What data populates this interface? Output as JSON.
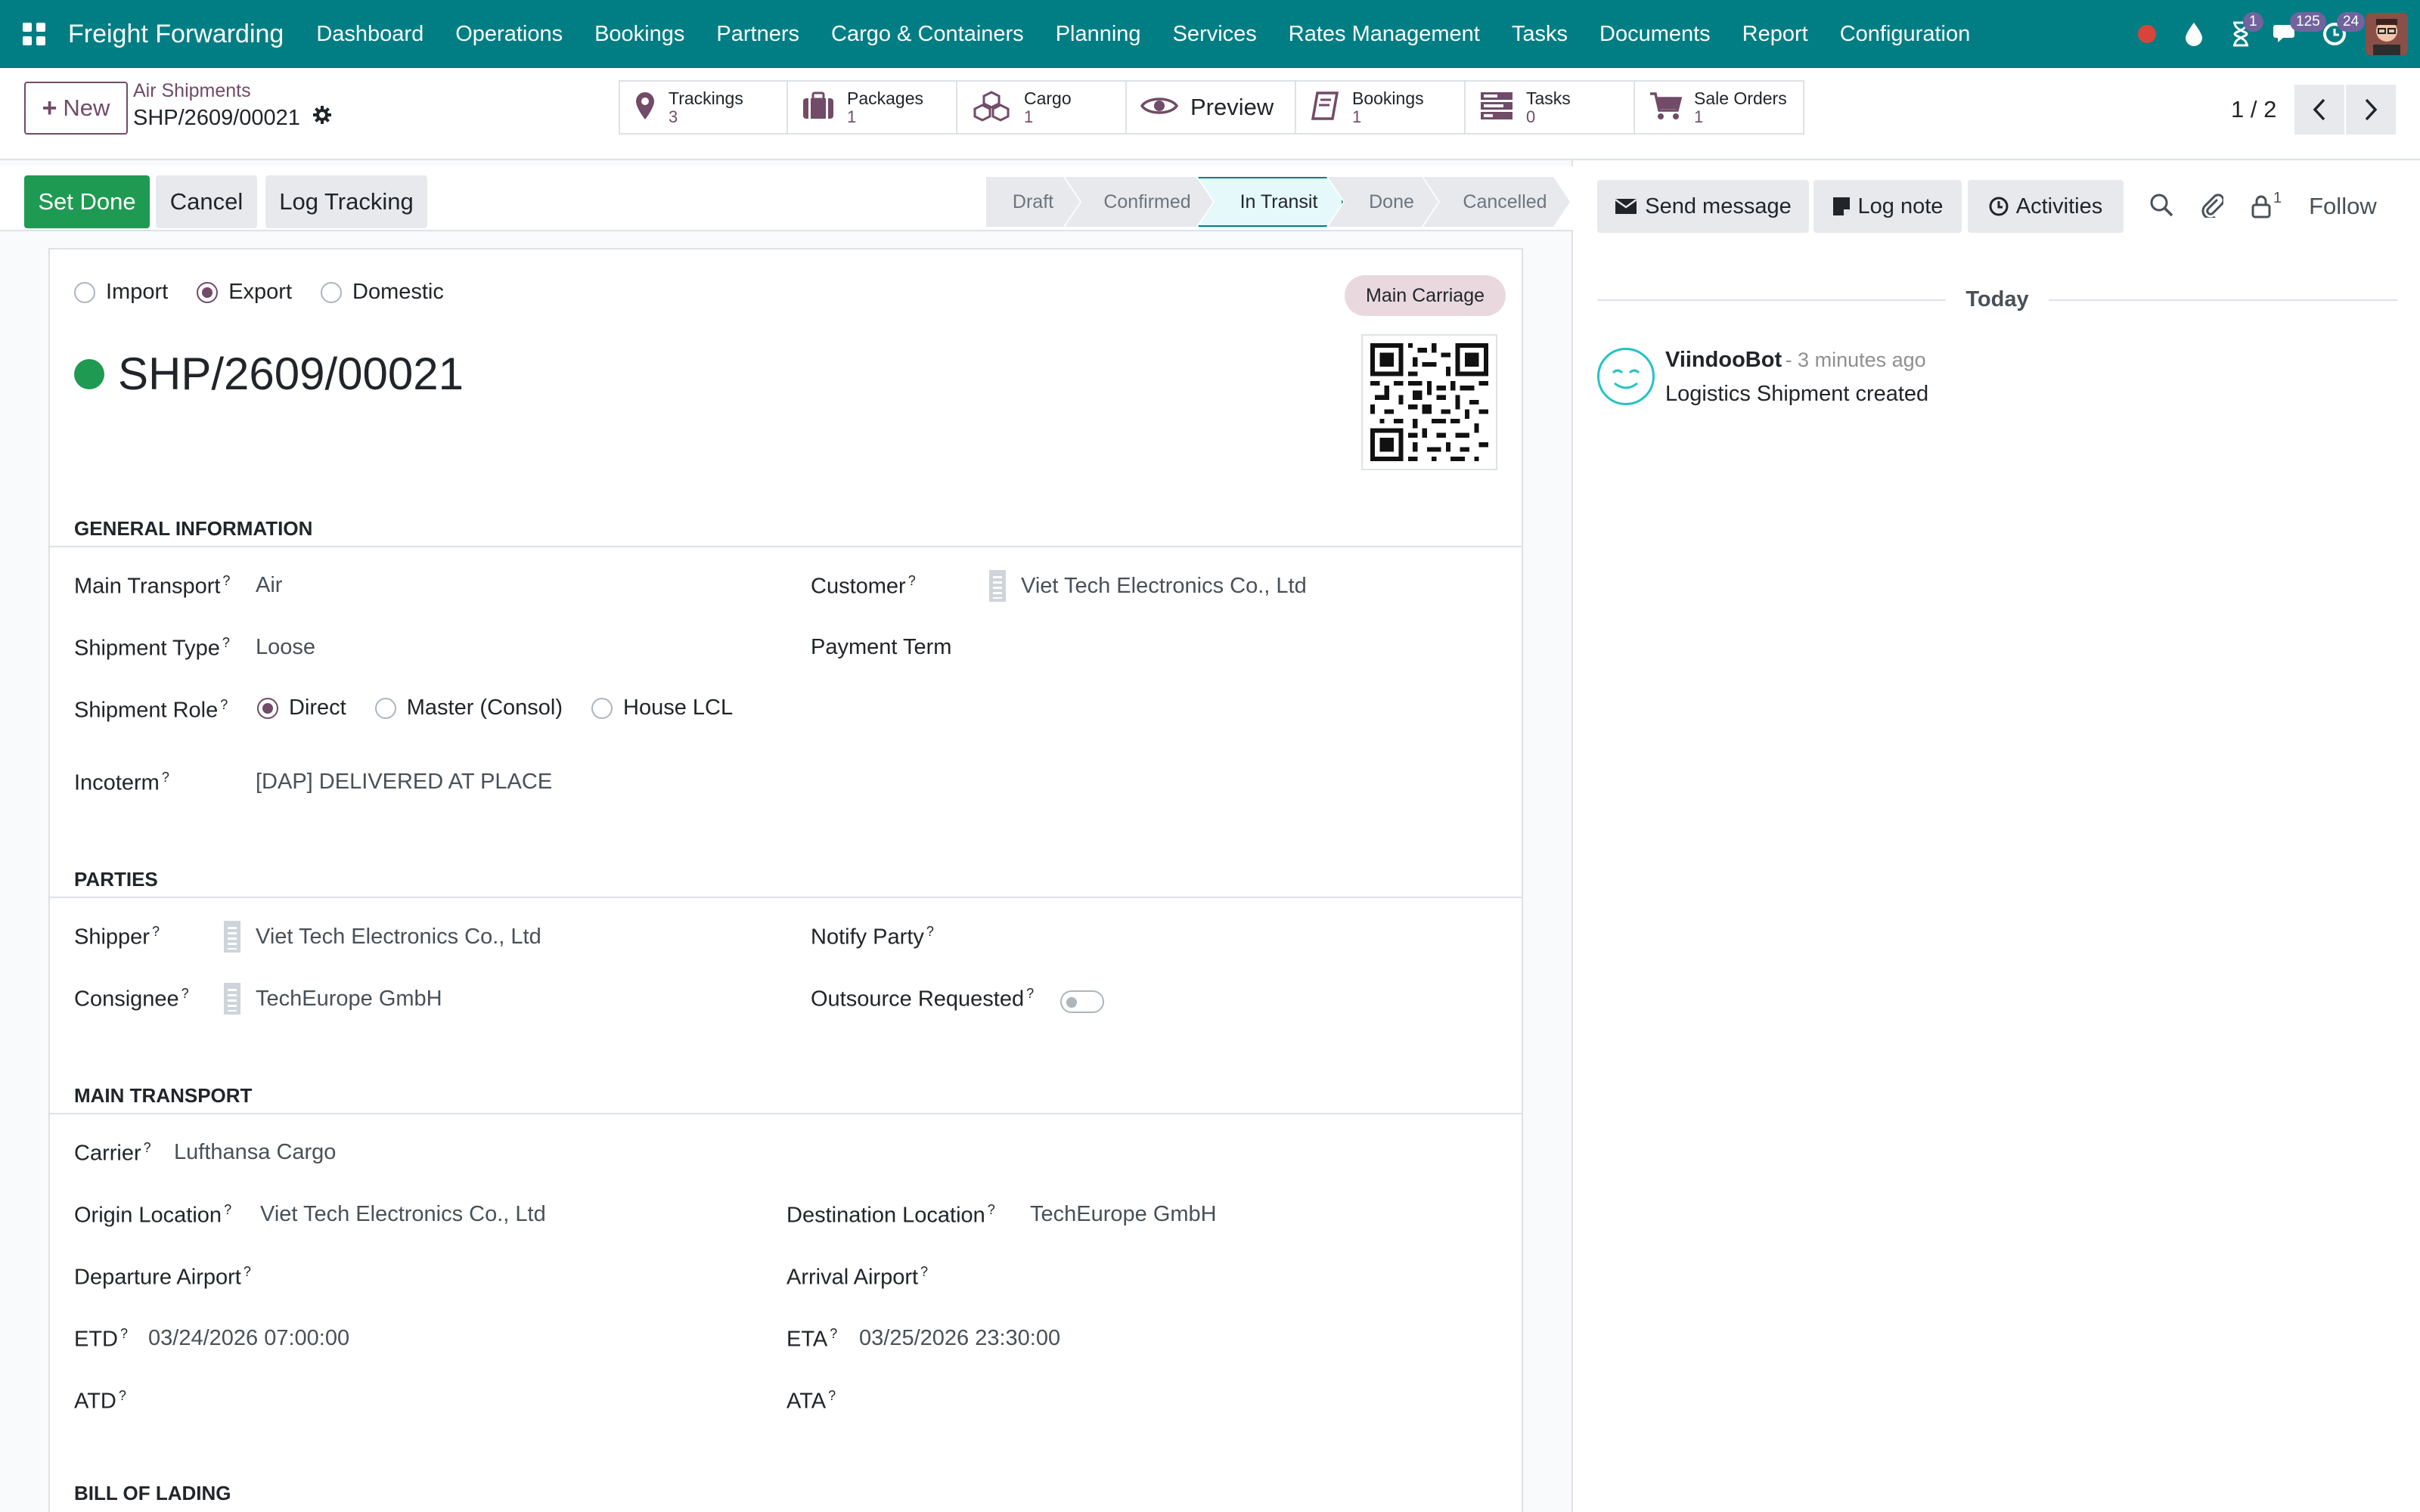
{
  "navbar": {
    "brand": "Freight Forwarding",
    "menu": [
      "Dashboard",
      "Operations",
      "Bookings",
      "Partners",
      "Cargo & Containers",
      "Planning",
      "Services",
      "Rates Management",
      "Tasks",
      "Documents",
      "Report",
      "Configuration"
    ],
    "badges": {
      "activities": "1",
      "messages": "125",
      "updates": "24"
    }
  },
  "control": {
    "new_label": "New",
    "breadcrumb_parent": "Air Shipments",
    "breadcrumb_current": "SHP/2609/00021",
    "smart_buttons": [
      {
        "label": "Trackings",
        "count": "3",
        "icon": "map-pin-icon"
      },
      {
        "label": "Packages",
        "count": "1",
        "icon": "suitcase-icon"
      },
      {
        "label": "Cargo",
        "count": "1",
        "icon": "cubes-icon"
      },
      {
        "label": "Preview",
        "icon": "eye-icon"
      },
      {
        "label": "Bookings",
        "count": "1",
        "icon": "book-icon"
      },
      {
        "label": "Tasks",
        "count": "0",
        "icon": "tasks-icon"
      },
      {
        "label": "Sale Orders",
        "count": "1",
        "icon": "cart-icon"
      }
    ],
    "pager": "1 / 2"
  },
  "statusbar": {
    "buttons": {
      "set_done": "Set Done",
      "cancel": "Cancel",
      "log_tracking": "Log Tracking"
    },
    "stages": [
      "Draft",
      "Confirmed",
      "In Transit",
      "Done",
      "Cancelled"
    ],
    "active_stage": "In Transit"
  },
  "form": {
    "direction_options": [
      "Import",
      "Export",
      "Domestic"
    ],
    "direction_selected": "Export",
    "tag": "Main Carriage",
    "title": "SHP/2609/00021",
    "sections": {
      "general": "GENERAL INFORMATION",
      "parties": "PARTIES",
      "main_transport": "MAIN TRANSPORT",
      "bill_of_lading": "BILL OF LADING"
    },
    "labels": {
      "main_transport": "Main Transport",
      "shipment_type": "Shipment Type",
      "shipment_role": "Shipment Role",
      "incoterm": "Incoterm",
      "customer": "Customer",
      "payment_term": "Payment Term",
      "shipper": "Shipper",
      "consignee": "Consignee",
      "notify_party": "Notify Party",
      "outsource_requested": "Outsource Requested",
      "carrier": "Carrier",
      "origin_location": "Origin Location",
      "destination_location": "Destination Location",
      "departure_airport": "Departure Airport",
      "arrival_airport": "Arrival Airport",
      "etd": "ETD",
      "eta": "ETA",
      "atd": "ATD",
      "ata": "ATA"
    },
    "values": {
      "main_transport": "Air",
      "shipment_type": "Loose",
      "shipment_role_options": [
        "Direct",
        "Master (Consol)",
        "House LCL"
      ],
      "shipment_role_selected": "Direct",
      "incoterm": "[DAP] DELIVERED AT PLACE",
      "customer": "Viet Tech Electronics Co., Ltd",
      "shipper": "Viet Tech Electronics Co., Ltd",
      "consignee": "TechEurope GmbH",
      "outsource_requested": false,
      "carrier": "Lufthansa Cargo",
      "origin_location": "Viet Tech Electronics Co., Ltd",
      "destination_location": "TechEurope GmbH",
      "etd": "03/24/2026 07:00:00",
      "eta": "03/25/2026 23:30:00"
    },
    "help_mark": "?"
  },
  "chatter": {
    "send_message": "Send message",
    "log_note": "Log note",
    "activities": "Activities",
    "follower_count": "1",
    "follow": "Follow",
    "today": "Today",
    "messages": [
      {
        "author": "ViindooBot",
        "date": "- 3 minutes ago",
        "body": "Logistics Shipment created"
      }
    ]
  },
  "colors": {
    "navbar": "#017e84",
    "primary": "#714b67",
    "success": "#1f9a52",
    "active_stage": "#e6f9fa"
  }
}
